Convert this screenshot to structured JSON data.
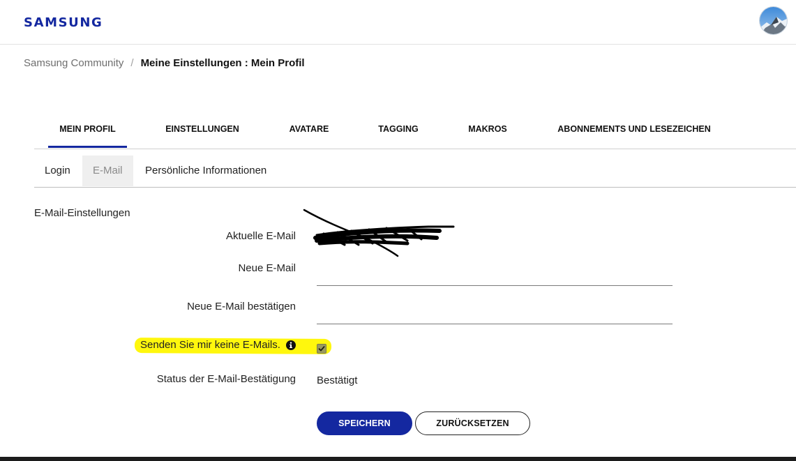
{
  "header": {
    "logo": "SAMSUNG",
    "brand_color": "#1428a0"
  },
  "breadcrumb": {
    "root": "Samsung Community",
    "separator": "/",
    "current": "Meine Einstellungen : Mein Profil"
  },
  "main_tabs": [
    {
      "label": "MEIN PROFIL",
      "active": true
    },
    {
      "label": "EINSTELLUNGEN",
      "active": false
    },
    {
      "label": "AVATARE",
      "active": false
    },
    {
      "label": "TAGGING",
      "active": false
    },
    {
      "label": "MAKROS",
      "active": false
    },
    {
      "label": "ABONNEMENTS UND LESEZEICHEN",
      "active": false
    }
  ],
  "sub_tabs": [
    {
      "label": "Login",
      "active": false
    },
    {
      "label": "E-Mail",
      "active": true
    },
    {
      "label": "Persönliche Informationen",
      "active": false
    }
  ],
  "form": {
    "section_title": "E-Mail-Einstellungen",
    "current_email_label": "Aktuelle E-Mail",
    "new_email_label": "Neue E-Mail",
    "new_email_value": "",
    "confirm_email_label": "Neue E-Mail bestätigen",
    "confirm_email_value": "",
    "optout_label": "Senden Sie mir keine E-Mails.",
    "optout_checked": true,
    "status_label": "Status der E-Mail-Bestätigung",
    "status_value": "Bestätigt",
    "save_label": "SPEICHERN",
    "reset_label": "ZURÜCKSETZEN"
  },
  "icons": {
    "info": "info-icon",
    "checkbox": "checkmark-icon"
  },
  "colors": {
    "highlight": "#fff700",
    "footer": "#1c1c1c"
  }
}
